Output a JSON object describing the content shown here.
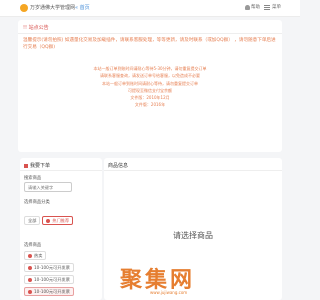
{
  "header": {
    "site_title": "万岁通佛大学管理网",
    "home_link": "« 首页",
    "help_label": "帮助",
    "menu_label": "菜单"
  },
  "notice": {
    "heading": "!! 站点公告",
    "main": "温馨提示(请勿拍照) 如遇量化交易及加载插件，请联系客服处理，等等更新，请及时联系（或加QQ群） ，请勿随意下单后进行交易（QQ群)",
    "lines": [
      "本站一般订单到账时间请耐心等待5-30分钟，请勿重复提交订单",
      "请联系客服查询，请发送订单号给客服，以免造成不必要",
      "本站一般订单到账时间请耐心等待，请勿重复提交订单",
      "可提现至微信支付宝余额",
      "文件版：2010年12月",
      "文件版：2016年"
    ]
  },
  "left": {
    "title": "我要下单",
    "search_label": "搜索商品",
    "search_placeholder": "请输入关键字",
    "category_label": "选择商品分类",
    "categories": [
      "全部",
      "热门推荐"
    ],
    "product_label": "选择商品",
    "products": [
      "热卖",
      "10-100元可开发票",
      "10-100元可开发票",
      "10-100元可开发票",
      "10-100元可开发票（可选"
    ]
  },
  "right": {
    "title": "商品信息",
    "placeholder": "请选择商品"
  },
  "watermark": {
    "text": "聚集网",
    "url": "www.jujiwang.com"
  }
}
